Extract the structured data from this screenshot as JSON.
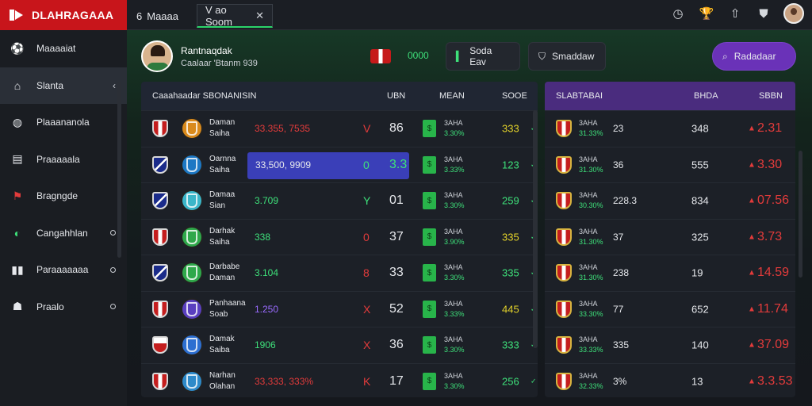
{
  "brand": {
    "title": "DLAHRAGAAA"
  },
  "tabs": [
    {
      "label": "Maaaa",
      "badge": "6"
    },
    {
      "label": "V ao Soom"
    }
  ],
  "colors": {
    "accent_red": "#c8151b",
    "accent_green": "#2bd46a",
    "accent_purple": "#6a32b8"
  },
  "topbar_icons": [
    "clock-icon",
    "trophy-icon",
    "upload-icon",
    "shield-icon",
    "avatar"
  ],
  "sidebar": {
    "items": [
      {
        "label": "Maaaaiat",
        "icon": "ball-icon",
        "active": false
      },
      {
        "label": "Slanta",
        "icon": "home-icon",
        "active": true,
        "chev": "‹"
      },
      {
        "label": "Plaaananola",
        "icon": "globe-icon",
        "active": false
      },
      {
        "label": "Praaaaala",
        "icon": "news-icon",
        "active": false
      },
      {
        "label": "Bragngde",
        "icon": "flag-icon",
        "active": false
      },
      {
        "label": "Cangahhlan",
        "icon": "shirt-icon",
        "active": false
      },
      {
        "label": "Paraaaaaaa",
        "icon": "stats-icon",
        "active": false
      },
      {
        "label": "Praalo",
        "icon": "people-icon",
        "active": false
      }
    ]
  },
  "header": {
    "name": "Rantnaqdak",
    "sub": "Caalaar 'Btanm 939",
    "flag_value": "0000",
    "btn1": "Soda Eav",
    "btn2": "Smaddaw",
    "btn3": "Radadaar"
  },
  "left_table": {
    "headers": {
      "title": "Caaahaadar SBONANISIN",
      "c1": "UBN",
      "c2": "MEAN",
      "c3": "SOOE"
    },
    "rows": [
      {
        "name1": "Daman",
        "name2": "Saiha",
        "score": "33.355, 7535",
        "score_color": "#e33b3b",
        "mark": "V",
        "mark_color": "#e33b3b",
        "num": "86",
        "sml": "3AHA",
        "smv": "3.30%",
        "last": "333",
        "last_color": "#e4d32a",
        "shield": "red",
        "crest": "#d98a1c"
      },
      {
        "name1": "Oarnna",
        "name2": "Saiha",
        "score": "33,500, 9909",
        "score_color": "#e6e8ec",
        "mark": "0",
        "mark_color": "#3ee07a",
        "num": "3.3",
        "num_color": "#3ee07a",
        "sml": "3AHA",
        "smv": "3.33%",
        "last": "123",
        "last_color": "#3ee07a",
        "shield": "blue",
        "crest": "#1d78c4",
        "highlight": true
      },
      {
        "name1": "Damaa",
        "name2": "Sian",
        "score": "3.709",
        "score_color": "#3ee07a",
        "mark": "Y",
        "mark_color": "#3ee07a",
        "num": "01",
        "sml": "3AHA",
        "smv": "3.30%",
        "last": "259",
        "last_color": "#3ee07a",
        "shield": "blue",
        "crest": "#3bb6c9"
      },
      {
        "name1": "Darhak",
        "name2": "Saiha",
        "score": "338",
        "score_color": "#3ee07a",
        "mark": "0",
        "mark_color": "#e33b3b",
        "num": "37",
        "sml": "3AHA",
        "smv": "3.90%",
        "last": "335",
        "last_color": "#e4d32a",
        "shield": "red",
        "crest": "#2fa84a"
      },
      {
        "name1": "Darbabe",
        "name2": "Daman",
        "score": "3.104",
        "score_color": "#3ee07a",
        "mark": "8",
        "mark_color": "#e33b3b",
        "num": "33",
        "sml": "3AHA",
        "smv": "3.30%",
        "last": "335",
        "last_color": "#3ee07a",
        "shield": "blue",
        "crest": "#2fa84a"
      },
      {
        "name1": "Panhaana",
        "name2": "Soab",
        "score": "1.250",
        "score_color": "#9a6bff",
        "mark": "X",
        "mark_color": "#e33b3b",
        "num": "52",
        "sml": "3AHA",
        "smv": "3.33%",
        "last": "445",
        "last_color": "#e4d32a",
        "shield": "red",
        "crest": "#5a3fbf"
      },
      {
        "name1": "Damak",
        "name2": "Saiba",
        "score": "1906",
        "score_color": "#3ee07a",
        "mark": "X",
        "mark_color": "#e33b3b",
        "num": "36",
        "sml": "3AHA",
        "smv": "3.30%",
        "last": "333",
        "last_color": "#3ee07a",
        "shield": "wr",
        "crest": "#2d6fd1"
      },
      {
        "name1": "Narhan",
        "name2": "Olahan",
        "score": "33,333, 333%",
        "score_color": "#e33b3b",
        "mark": "K",
        "mark_color": "#e33b3b",
        "num": "17",
        "sml": "3AHA",
        "smv": "3.30%",
        "last": "256",
        "last_color": "#3ee07a",
        "shield": "red",
        "crest": "#2e8ac9"
      }
    ]
  },
  "right_table": {
    "headers": {
      "title": "SLABTABAI",
      "c1": "BHDA",
      "c2": "SBBN"
    },
    "rows": [
      {
        "sml": "3AHA",
        "smv": "31.33%",
        "v1": "23",
        "v2": "348",
        "v3": "2.31",
        "v3_color": "#e33b3b"
      },
      {
        "sml": "3AHA",
        "smv": "31.30%",
        "v1": "36",
        "v2": "555",
        "v3": "3.30",
        "v3_color": "#e33b3b"
      },
      {
        "sml": "3AHA",
        "smv": "30.30%",
        "v1": "228.3",
        "v2": "834",
        "v3": "07.56",
        "v3_color": "#e33b3b"
      },
      {
        "sml": "3AHA",
        "smv": "31.30%",
        "v1": "37",
        "v2": "325",
        "v3": "3.73",
        "v3_color": "#e33b3b"
      },
      {
        "sml": "3AHA",
        "smv": "31.30%",
        "v1": "238",
        "v2": "19",
        "v3": "14.59",
        "v3_color": "#e33b3b"
      },
      {
        "sml": "3AHA",
        "smv": "33.30%",
        "v1": "77",
        "v2": "652",
        "v3": "11.74",
        "v3_color": "#e33b3b"
      },
      {
        "sml": "3AHA",
        "smv": "33.33%",
        "v1": "335",
        "v2": "140",
        "v3": "37.09",
        "v3_color": "#e33b3b"
      },
      {
        "sml": "3AHA",
        "smv": "32.33%",
        "v1": "3%",
        "v2": "13",
        "v3": "3.3.53",
        "v3_color": "#e33b3b"
      }
    ]
  }
}
